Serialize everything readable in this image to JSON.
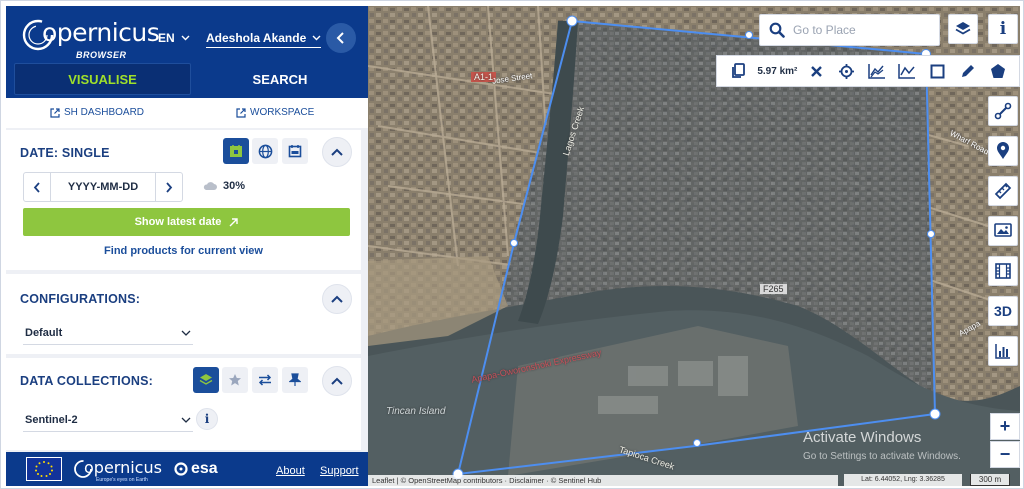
{
  "header": {
    "logo_text": "opernicus",
    "logo_sub": "BROWSER",
    "language": "EN",
    "user_name": "Adeshola Akande",
    "tabs": {
      "visualise": "VISUALISE",
      "search": "SEARCH"
    }
  },
  "links": {
    "sh_dashboard": "SH DASHBOARD",
    "workspace": "WORKSPACE"
  },
  "date_panel": {
    "title": "DATE: SINGLE",
    "date_placeholder": "YYYY-MM-DD",
    "cloud_coverage": "30%",
    "show_latest_label": "Show latest date",
    "find_products_label": "Find products for current view"
  },
  "config_panel": {
    "title": "CONFIGURATIONS:",
    "selected": "Default"
  },
  "data_panel": {
    "title": "DATA COLLECTIONS:",
    "selected": "Sentinel-2"
  },
  "footer": {
    "copernicus": "opernicus",
    "copernicus_sub": "Europe's eyes on Earth",
    "esa": "esa",
    "about": "About",
    "support": "Support"
  },
  "map": {
    "search_placeholder": "Go to Place",
    "area": "5.97 km²",
    "watermark_title": "Activate Windows",
    "watermark_sub": "Go to Settings to activate Windows.",
    "attribution": "Leaflet | © OpenStreetMap contributors · Disclaimer · © Sentinel Hub",
    "lat_lng": "Lat: 6.44052, Lng: 3.36285",
    "scale": "300 m",
    "view_3d_label": "3D",
    "zoom_in": "+",
    "zoom_out": "−",
    "labels": {
      "a1": "A1-1",
      "jose_street": "Jose Street",
      "lagos_creek": "Lagos Creek",
      "f265": "F265",
      "expressway": "Apapa-Oworonshoki Expressway",
      "tincan": "Tincan Island",
      "tapioca_creek": "Tapioca Creek",
      "wharf_road": "Wharf Road",
      "apapa": "Apapa"
    }
  },
  "colors": {
    "brand_blue": "#0b3a8c",
    "accent_green": "#8ec63f",
    "polygon": "#4d8ef0"
  }
}
